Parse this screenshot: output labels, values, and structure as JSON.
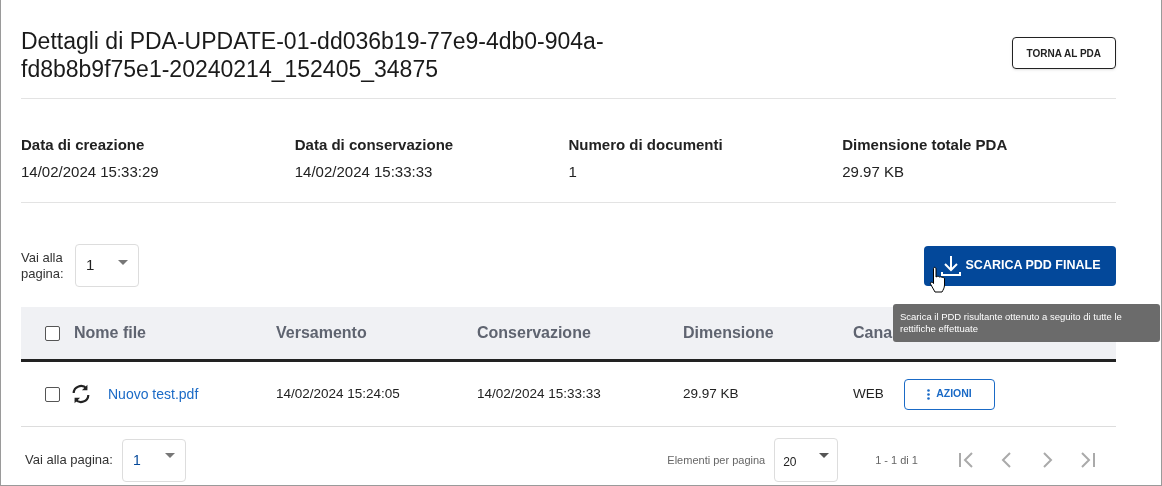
{
  "title": "Dettagli di PDA-UPDATE-01-dd036b19-77e9-4db0-904a-fd8b8b9f75e1-20240214_152405_34875",
  "back_button": "TORNA AL PDA",
  "summary": [
    {
      "label": "Data di creazione",
      "value": "14/02/2024 15:33:29"
    },
    {
      "label": "Data di conservazione",
      "value": "14/02/2024 15:33:33"
    },
    {
      "label": "Numero di documenti",
      "value": "1"
    },
    {
      "label": "Dimensione totale PDA",
      "value": "29.97 KB"
    }
  ],
  "top_pager": {
    "label": "Vai alla pagina:",
    "value": "1"
  },
  "download_button": "SCARICA PDD FINALE",
  "tooltip": "Scarica il PDD risultante ottenuto a seguito di tutte le rettifiche effettuate",
  "table": {
    "select_all_checked": false,
    "columns": [
      "Nome file",
      "Versamento",
      "Conservazione",
      "Dimensione",
      "Cana"
    ],
    "rows": [
      {
        "checked": false,
        "file": "Nuovo test.pdf",
        "versamento": "14/02/2024 15:24:05",
        "conservazione": "14/02/2024 15:33:33",
        "dimensione": "29.97 KB",
        "canale": "WEB",
        "action": "AZIONI"
      }
    ]
  },
  "footer": {
    "page_label": "Vai alla pagina:",
    "page_value": "1",
    "per_page_label": "Elementi per pagina",
    "per_page_value": "20",
    "range": "1 - 1 di 1"
  }
}
